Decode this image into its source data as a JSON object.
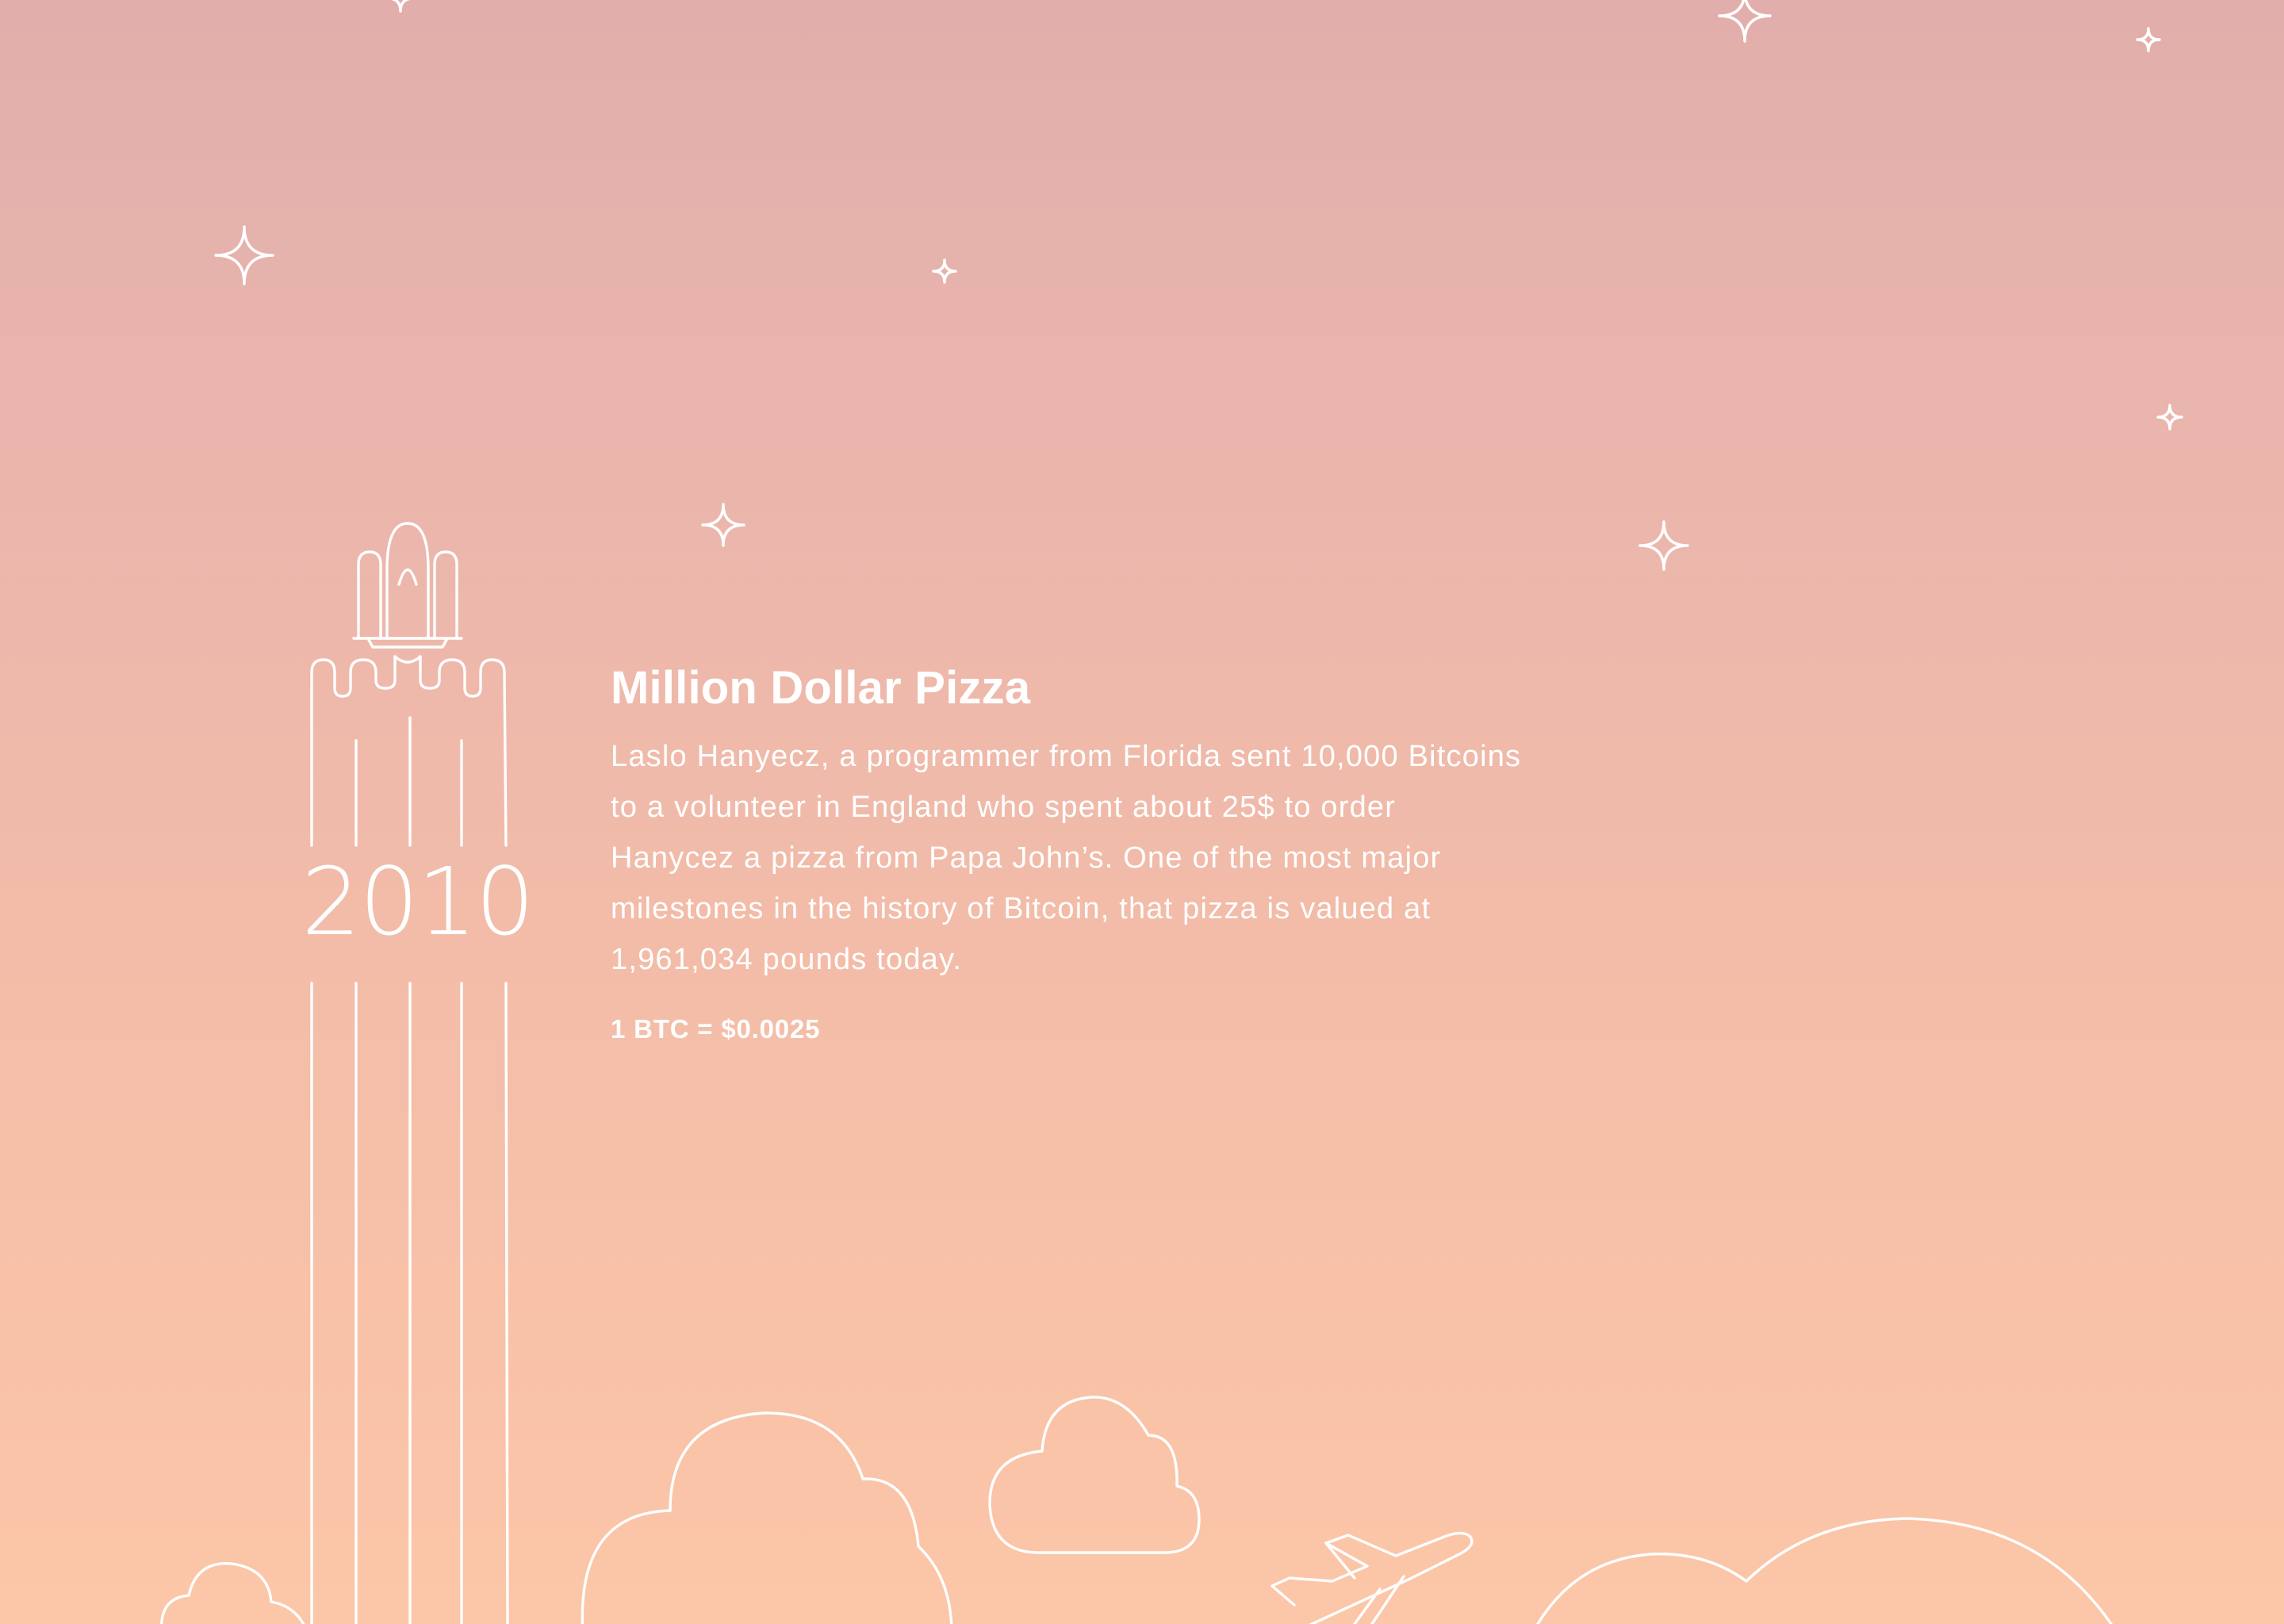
{
  "milestone": {
    "year": "2010",
    "title": "Million Dollar Pizza",
    "description": "Laslo Hanyecz, a programmer from Florida sent 10,000 Bitcoins to a volunteer in England who spent about 25$ to order Hanycez a pizza from Papa John’s. One of the most major milestones in the history of Bitcoin, that pizza is valued at 1,961,034 pounds today.",
    "rate": "1 BTC = $0.0025"
  },
  "decorations": {
    "rocket_icon": "space-shuttle-launch-icon",
    "star_icon": "sparkle-star-icon",
    "cloud_icon": "cloud-icon",
    "airplane_icon": "airplane-icon"
  },
  "colors": {
    "gradient_top": "#e2aeab",
    "gradient_bottom": "#fcc6a8",
    "line_art": "#ffffff",
    "text": "#ffffff"
  }
}
